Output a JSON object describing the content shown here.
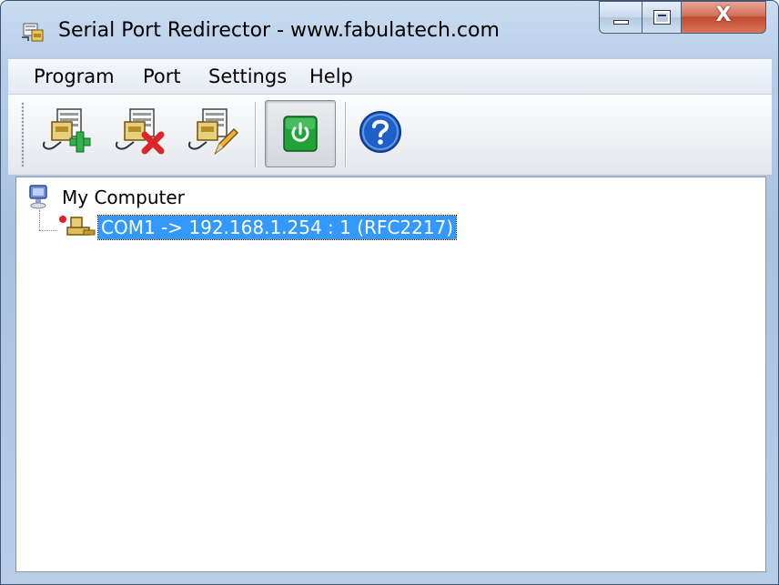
{
  "window": {
    "title": "Serial Port Redirector - www.fabulatech.com",
    "controls": {
      "minimize": "minimize",
      "maximize": "maximize",
      "close": "X"
    }
  },
  "menu": {
    "items": [
      "Program",
      "Port",
      "Settings",
      "Help"
    ]
  },
  "toolbar": {
    "buttons": [
      {
        "name": "add-port",
        "icon": "port-add-icon"
      },
      {
        "name": "remove-port",
        "icon": "port-remove-icon"
      },
      {
        "name": "edit-port",
        "icon": "port-edit-icon"
      },
      {
        "name": "power",
        "icon": "power-icon",
        "state": "pressed"
      },
      {
        "name": "help",
        "icon": "help-icon"
      }
    ]
  },
  "tree": {
    "root": {
      "label": "My Computer",
      "icon": "computer-icon"
    },
    "children": [
      {
        "label": "COM1 -> 192.168.1.254 : 1 (RFC2217)",
        "icon": "network-port-icon",
        "selected": true
      }
    ]
  },
  "colors": {
    "selection": "#3399ff",
    "close_button": "#c24a2f",
    "power_green": "#22a33a",
    "help_blue": "#1e5fc8",
    "add_green": "#2fb24a",
    "remove_red": "#d9262b"
  }
}
